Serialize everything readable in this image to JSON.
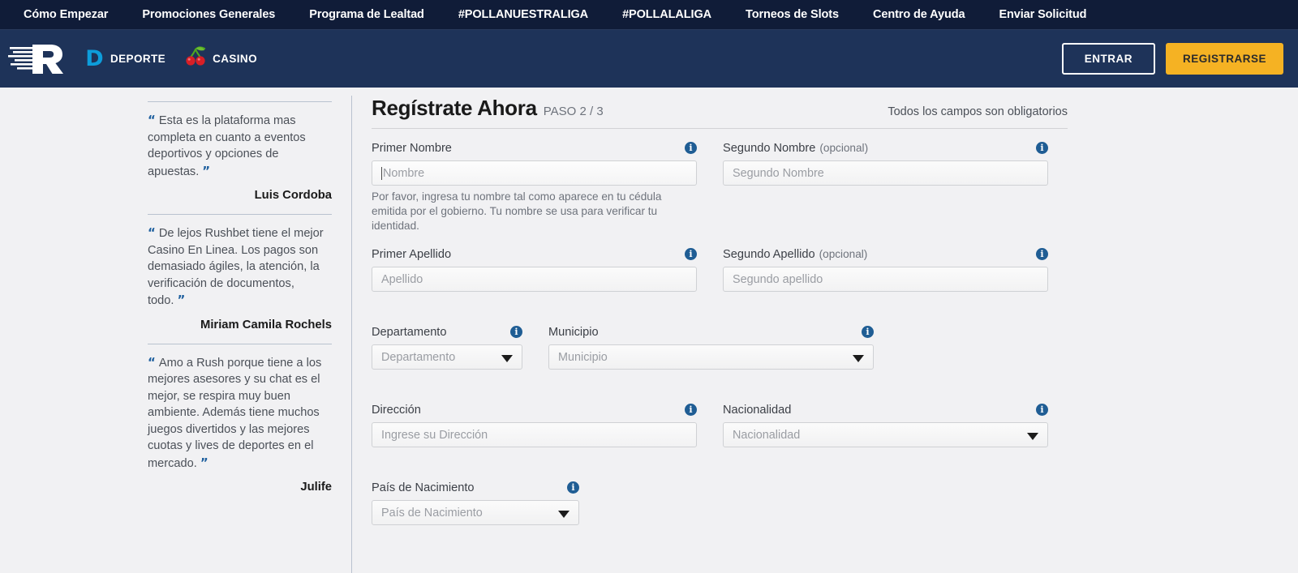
{
  "top_nav": {
    "items": [
      {
        "label": "Cómo Empezar",
        "name": "como-empezar"
      },
      {
        "label": "Promociones Generales",
        "name": "promociones-generales"
      },
      {
        "label": "Programa de Lealtad",
        "name": "programa-de-lealtad"
      },
      {
        "label": "#POLLANUESTRALIGA",
        "name": "pollanuestraliga"
      },
      {
        "label": "#POLLALALIGA",
        "name": "pollalaliga"
      },
      {
        "label": "Torneos de Slots",
        "name": "torneos-de-slots"
      },
      {
        "label": "Centro de Ayuda",
        "name": "centro-de-ayuda"
      },
      {
        "label": "Enviar Solicitud",
        "name": "enviar-solicitud"
      }
    ]
  },
  "header": {
    "logo_letter": "R",
    "sport_badge": "D",
    "sport_label": "DEPORTE",
    "casino_label": "CASINO",
    "login_label": "ENTRAR",
    "register_label": "REGISTRARSE"
  },
  "colors": {
    "top_nav_bg": "#101c38",
    "header_bg": "#1e3359",
    "page_bg": "#f1f1f3",
    "accent_yellow": "#f5b223",
    "accent_blue": "#0d9ddb",
    "info_blue": "#1f5d94",
    "quote_blue": "#1e5f9e"
  },
  "testimonials": [
    {
      "text": "Esta es la plataforma mas completa en cuanto a eventos deportivos y opciones de apuestas.",
      "author": "Luis Cordoba"
    },
    {
      "text": "De lejos Rushbet tiene el mejor Casino En Linea. Los pagos son demasiado ágiles, la atención, la verificación de documentos, todo.",
      "author": "Miriam Camila Rochels"
    },
    {
      "text": "Amo a Rush porque tiene a los mejores asesores y su chat es el mejor, se respira muy buen ambiente. Además tiene muchos juegos divertidos y las mejores cuotas y lives de deportes en el mercado.",
      "author": "Julife"
    }
  ],
  "form": {
    "title": "Regístrate Ahora",
    "step": "PASO 2 / 3",
    "required_note": "Todos los campos son obligatorios",
    "fields": {
      "primer_nombre": {
        "label": "Primer Nombre",
        "placeholder": "Nombre",
        "helper": "Por favor, ingresa tu nombre tal como aparece en tu cédula emitida por el gobierno. Tu nombre se usa para verificar tu identidad."
      },
      "segundo_nombre": {
        "label": "Segundo Nombre",
        "optional": "(opcional)",
        "placeholder": "Segundo Nombre"
      },
      "primer_apellido": {
        "label": "Primer Apellido",
        "placeholder": "Apellido"
      },
      "segundo_apellido": {
        "label": "Segundo Apellido",
        "optional": "(opcional)",
        "placeholder": "Segundo apellido"
      },
      "departamento": {
        "label": "Departamento",
        "placeholder": "Departamento"
      },
      "municipio": {
        "label": "Municipio",
        "placeholder": "Municipio"
      },
      "direccion": {
        "label": "Dirección",
        "placeholder": "Ingrese su Dirección"
      },
      "nacionalidad": {
        "label": "Nacionalidad",
        "placeholder": "Nacionalidad"
      },
      "pais_nacimiento": {
        "label": "País de Nacimiento",
        "placeholder": "País de Nacimiento"
      }
    },
    "info_icon_glyph": "i"
  }
}
